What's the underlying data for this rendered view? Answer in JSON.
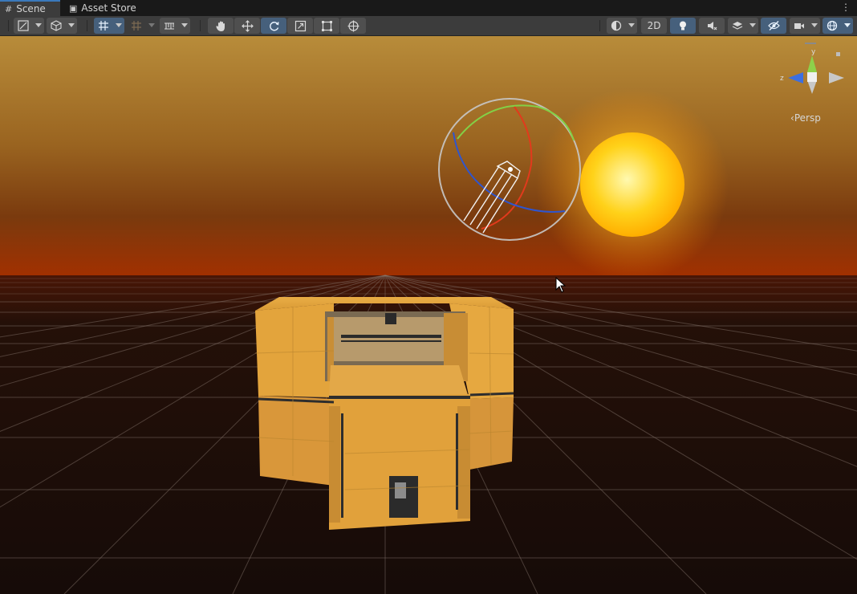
{
  "tabs": [
    {
      "label": "Scene",
      "icon": "grid-icon",
      "active": true
    },
    {
      "label": "Asset Store",
      "icon": "bag-icon",
      "active": false
    }
  ],
  "toolbar": {
    "two_d_label": "2D",
    "tools": [
      "draw-mode",
      "shading",
      "grid-snap",
      "increment-snap",
      "grid-visibility",
      "hand",
      "move",
      "rotate",
      "scale",
      "rect",
      "transform"
    ],
    "active_tool": "rotate",
    "accent": "#3a79bb"
  },
  "scene": {
    "orientation_label": "Persp",
    "axis_y": "y",
    "axis_z": "z",
    "sky_top": "#b88c3a",
    "horizon": "#a23000",
    "ground": "#160b08",
    "crate_color": "#e6a53a"
  }
}
